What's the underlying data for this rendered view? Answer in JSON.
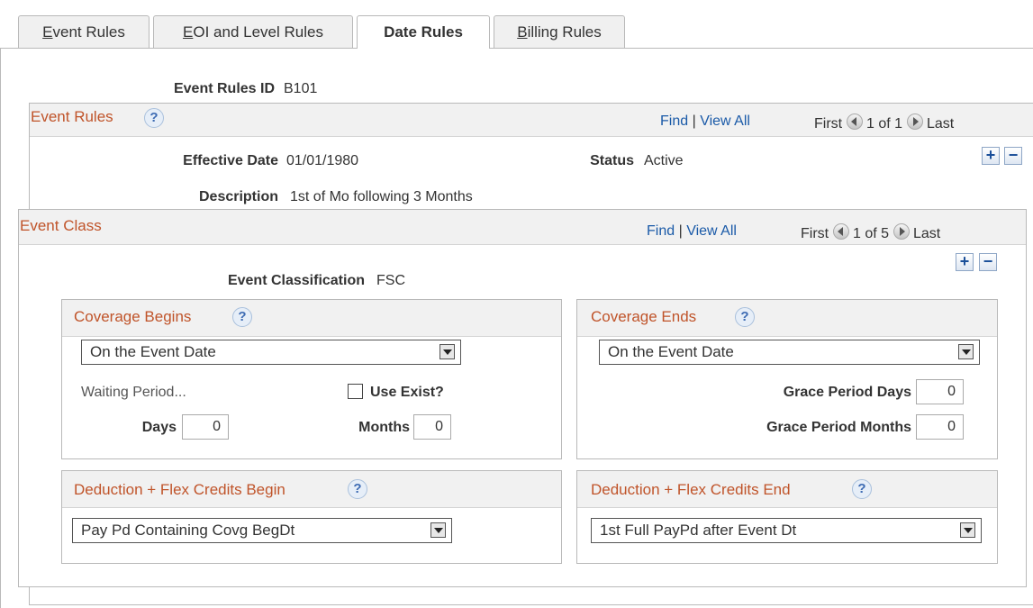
{
  "tabs": [
    {
      "label_u": "E",
      "label_rest": "vent Rules"
    },
    {
      "label_u": "E",
      "label_rest": "OI and Level Rules"
    },
    {
      "label": "Date Rules"
    },
    {
      "label_u": "B",
      "label_rest": "illing Rules"
    }
  ],
  "event_rules_id": {
    "label": "Event Rules ID",
    "value": "B101"
  },
  "event_rules_section": {
    "title": "Event Rules",
    "find": "Find",
    "sep": "|",
    "view_all": "View All",
    "first": "First",
    "count": "1 of 1",
    "last": "Last"
  },
  "effective_date": {
    "label": "Effective Date",
    "value": "01/01/1980"
  },
  "status": {
    "label": "Status",
    "value": "Active"
  },
  "description": {
    "label": "Description",
    "value": "1st of Mo following 3 Months"
  },
  "event_class_section": {
    "title": "Event Class",
    "find": "Find",
    "sep": "|",
    "view_all": "View All",
    "first": "First",
    "count": "1 of 5",
    "last": "Last"
  },
  "event_classification": {
    "label": "Event Classification",
    "value": "FSC"
  },
  "coverage_begins": {
    "title": "Coverage Begins",
    "selected": "On the Event Date",
    "waiting_period": "Waiting Period...",
    "use_exist_label": "Use Exist?",
    "use_exist_checked": false,
    "days_label": "Days",
    "days_value": "0",
    "months_label": "Months",
    "months_value": "0"
  },
  "coverage_ends": {
    "title": "Coverage Ends",
    "selected": "On the Event Date",
    "grace_days_label": "Grace Period Days",
    "grace_days_value": "0",
    "grace_months_label": "Grace Period Months",
    "grace_months_value": "0"
  },
  "deduction_begin": {
    "title": "Deduction + Flex Credits Begin",
    "selected": "Pay Pd Containing Covg BegDt"
  },
  "deduction_end": {
    "title": "Deduction + Flex Credits End",
    "selected": "1st Full PayPd after Event Dt"
  },
  "icons": {
    "help": "?",
    "plus": "+",
    "minus": "−"
  },
  "colors": {
    "section_title": "#c0542a",
    "link": "#1a5aa8",
    "header_bg": "#f1f1f1"
  }
}
